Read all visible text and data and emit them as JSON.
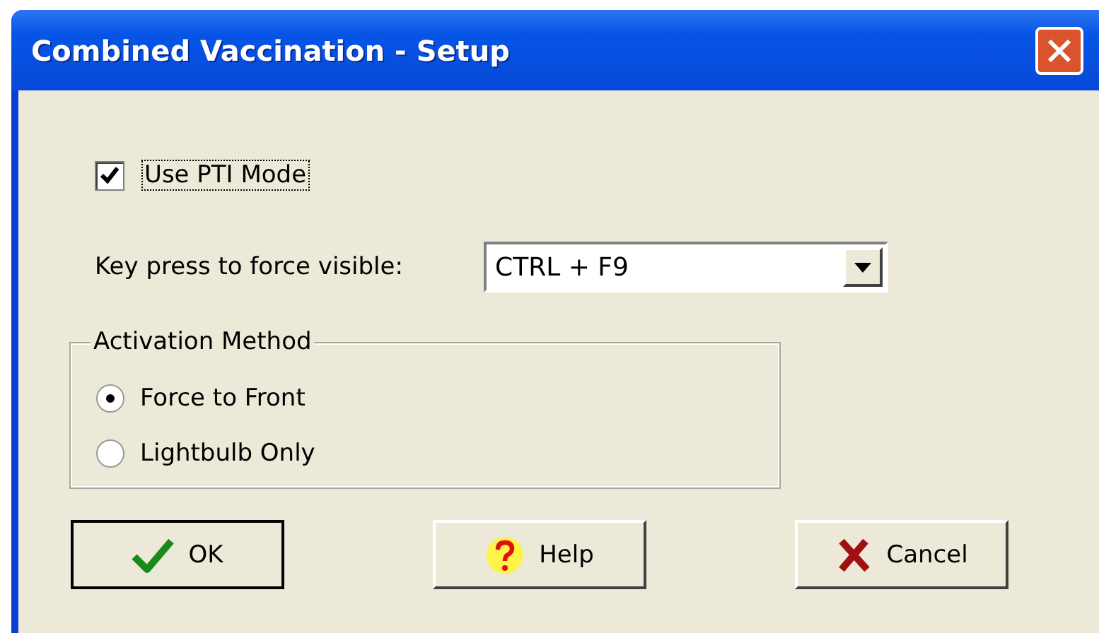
{
  "window": {
    "title": "Combined Vaccination - Setup"
  },
  "use_pti_mode": {
    "label": "Use PTI Mode",
    "checked": true
  },
  "key_press": {
    "label": "Key press to force visible:",
    "value": "CTRL + F9"
  },
  "activation_method": {
    "title": "Activation Method",
    "options": [
      {
        "label": "Force to Front",
        "selected": true
      },
      {
        "label": "Lightbulb Only",
        "selected": false
      }
    ]
  },
  "buttons": [
    {
      "kind": "ok",
      "label": "OK"
    },
    {
      "kind": "help",
      "label": "Help"
    },
    {
      "kind": "cancel",
      "label": "Cancel"
    }
  ]
}
